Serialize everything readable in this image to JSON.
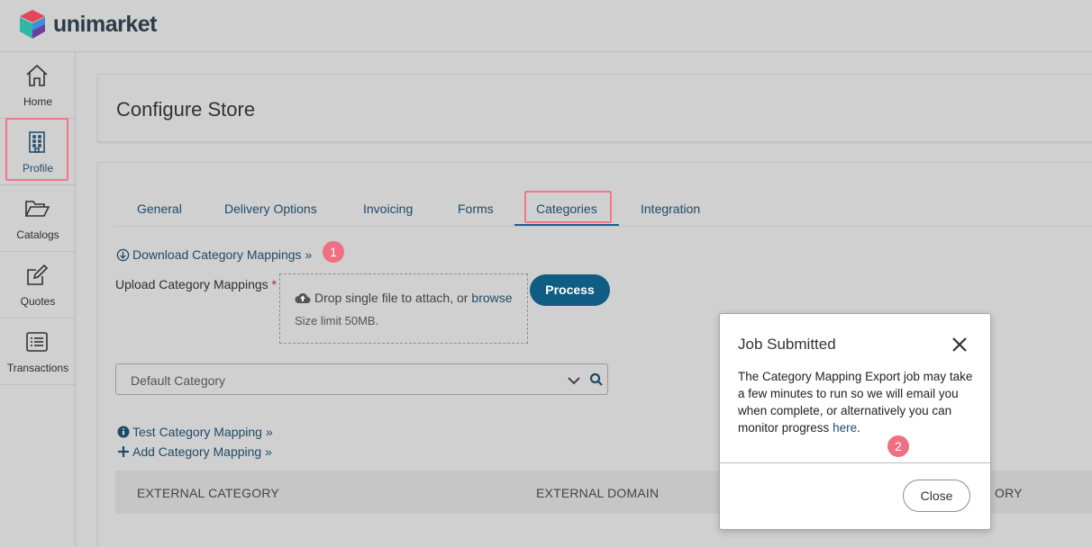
{
  "app": {
    "name": "unimarket"
  },
  "sidebar": {
    "items": [
      {
        "label": "Home",
        "icon": "home-icon"
      },
      {
        "label": "Profile",
        "icon": "building-icon"
      },
      {
        "label": "Catalogs",
        "icon": "folder-open-icon"
      },
      {
        "label": "Quotes",
        "icon": "edit-icon"
      },
      {
        "label": "Transactions",
        "icon": "list-icon"
      }
    ]
  },
  "page": {
    "title": "Configure Store"
  },
  "tabs": [
    {
      "label": "General"
    },
    {
      "label": "Delivery Options"
    },
    {
      "label": "Invoicing"
    },
    {
      "label": "Forms"
    },
    {
      "label": "Categories",
      "active": true
    },
    {
      "label": "Integration"
    }
  ],
  "categories": {
    "download_link": "Download Category Mappings »",
    "step1": "1",
    "upload_label": "Upload Category Mappings",
    "required_mark": "*",
    "drop_text": "Drop single file to attach, or",
    "browse": "browse",
    "size_limit": "Size limit 50MB.",
    "process_button": "Process",
    "default_category": "Default Category",
    "test_link": "Test Category Mapping »",
    "add_link": "Add Category Mapping »",
    "table_headers": [
      "EXTERNAL CATEGORY",
      "EXTERNAL DOMAIN",
      "ORY"
    ]
  },
  "modal": {
    "title": "Job Submitted",
    "body": "The Category Mapping Export job may take a few minutes to run so we will email you when complete, or alternatively you can monitor progress",
    "link": "here",
    "period": ".",
    "step2": "2",
    "close_button": "Close"
  },
  "colors": {
    "accent": "#0f5d83",
    "link": "#1e4b6a",
    "highlight": "#f0788a",
    "badge": "#ef6f83"
  }
}
